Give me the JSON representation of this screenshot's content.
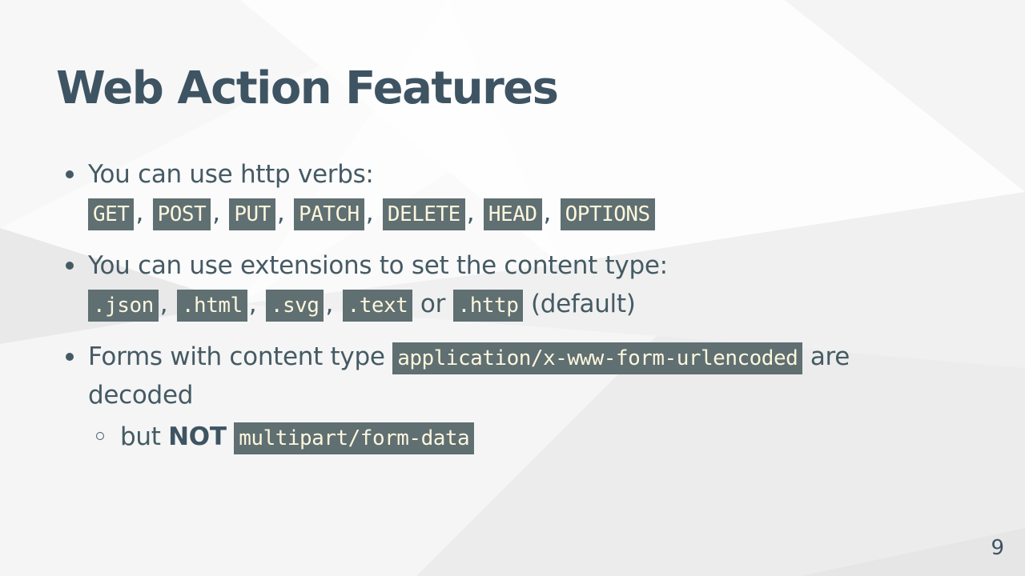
{
  "slide": {
    "title": "Web Action Features",
    "page_number": "9"
  },
  "bullets": [
    {
      "text": "You can use http verbs:",
      "codes": [
        "GET",
        "POST",
        "PUT",
        "PATCH",
        "DELETE",
        "HEAD",
        "OPTIONS"
      ]
    },
    {
      "text": "You can use extensions to set the content type:",
      "codes": [
        ".json",
        ".html",
        ".svg",
        ".text",
        ".http"
      ],
      "joiner_or": "or",
      "suffix": "(default)"
    },
    {
      "text_before": "Forms with content type",
      "code": "application/x-www-form-urlencoded",
      "text_after": "are",
      "text_wrap": "decoded",
      "sub": {
        "text_before": "but",
        "strong": "NOT",
        "code": "multipart/form-data"
      }
    }
  ],
  "punctuation": {
    "comma": ","
  },
  "colors": {
    "text": "#455a64",
    "title": "#3e5463",
    "code_bg": "#5f6f72",
    "code_text": "#fdf6dc"
  }
}
